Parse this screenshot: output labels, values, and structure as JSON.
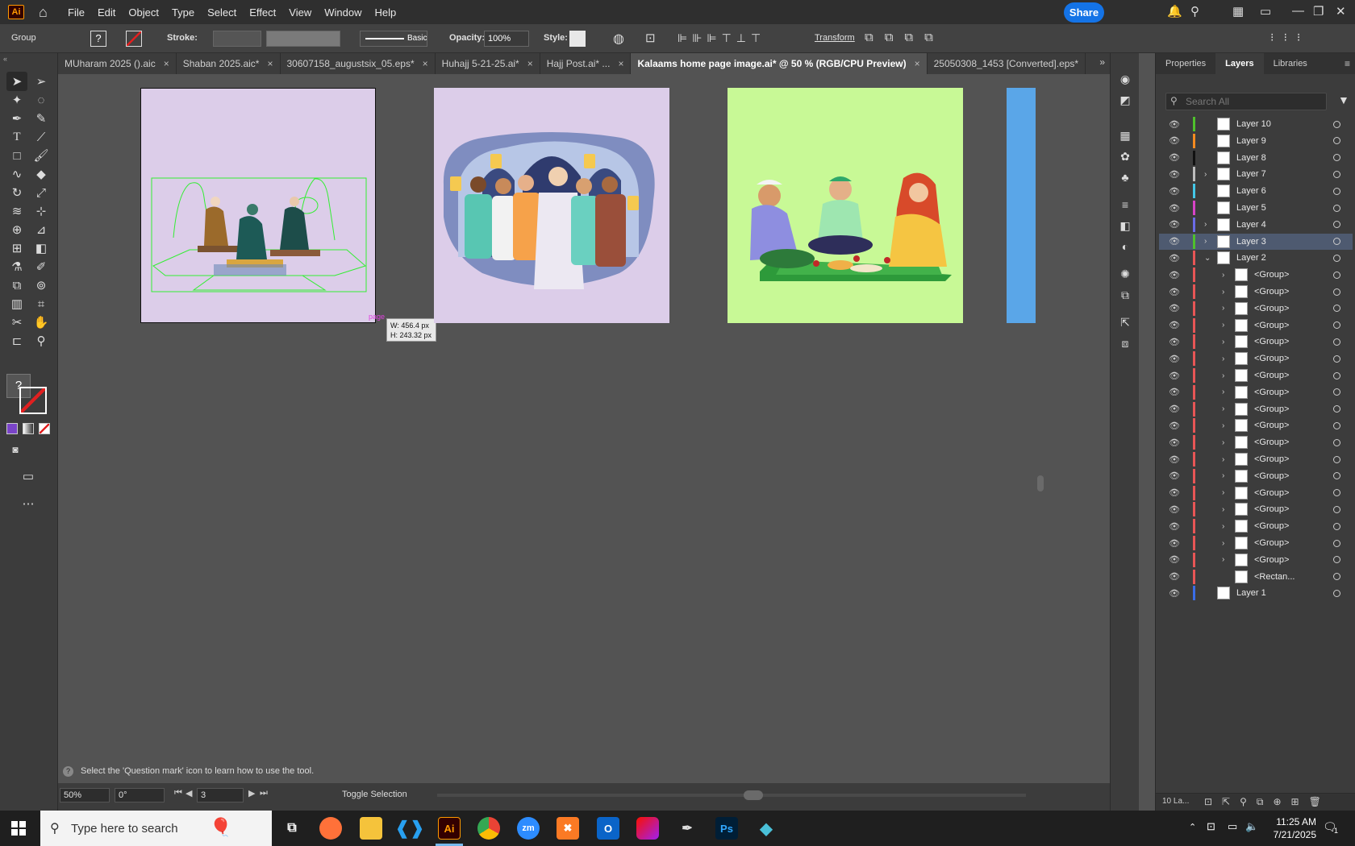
{
  "app": {
    "logo": "Ai",
    "menu": [
      "File",
      "Edit",
      "Object",
      "Type",
      "Select",
      "Effect",
      "View",
      "Window",
      "Help"
    ],
    "share_label": "Share"
  },
  "control_bar": {
    "selection_type": "Group",
    "stroke_label": "Stroke:",
    "brush_style": "Basic",
    "opacity_label": "Opacity:",
    "opacity_value": "100%",
    "style_label": "Style:",
    "transform_label": "Transform"
  },
  "tabs": [
    {
      "label": "MUharam 2025 ().aic",
      "close": "×"
    },
    {
      "label": "Shaban 2025.aic*",
      "close": "×"
    },
    {
      "label": "30607158_augustsix_05.eps*",
      "close": "×"
    },
    {
      "label": "Huhajj 5-21-25.ai*",
      "close": "×"
    },
    {
      "label": "Hajj Post.ai* ...",
      "close": "×"
    },
    {
      "label": "Kalaams home page image.ai* @ 50 % (RGB/CPU Preview)",
      "close": "×"
    },
    {
      "label": "25050308_1453 [Converted].eps*",
      "close": ""
    }
  ],
  "canvas": {
    "tooltip_w": "W: 456.4 px",
    "tooltip_h": "H: 243.32 px",
    "smart_guide": "page",
    "artboard_colors": [
      "#dccde9",
      "#dccde9",
      "#c8f996",
      "#5aa6e8"
    ]
  },
  "status": {
    "hint": "Select the 'Question mark' icon to learn how to use the tool.",
    "zoom": "50%",
    "rotation": "0°",
    "artboard_num": "3",
    "mode": "Toggle Selection"
  },
  "layers_panel": {
    "tabs": [
      "Properties",
      "Layers",
      "Libraries"
    ],
    "search_placeholder": "Search All",
    "footer_count": "10 La...",
    "layers": [
      {
        "name": "Layer 10",
        "color": "#4fc12c",
        "indent": 0,
        "expand": "",
        "selected": false
      },
      {
        "name": "Layer 9",
        "color": "#f48b20",
        "indent": 0,
        "expand": "",
        "selected": false
      },
      {
        "name": "Layer 8",
        "color": "#111111",
        "indent": 0,
        "expand": "",
        "selected": false
      },
      {
        "name": "Layer 7",
        "color": "#bdbdbd",
        "indent": 0,
        "expand": ">",
        "selected": false
      },
      {
        "name": "Layer 6",
        "color": "#44c8e8",
        "indent": 0,
        "expand": "",
        "selected": false
      },
      {
        "name": "Layer 5",
        "color": "#d844c8",
        "indent": 0,
        "expand": "",
        "selected": false
      },
      {
        "name": "Layer 4",
        "color": "#6b6be8",
        "indent": 0,
        "expand": ">",
        "selected": false
      },
      {
        "name": "Layer 3",
        "color": "#4fc12c",
        "indent": 0,
        "expand": ">",
        "selected": true
      },
      {
        "name": "Layer 2",
        "color": "#e85656",
        "indent": 0,
        "expand": "v",
        "selected": false
      },
      {
        "name": "<Group>",
        "color": "#e85656",
        "indent": 1,
        "expand": ">",
        "selected": false
      },
      {
        "name": "<Group>",
        "color": "#e85656",
        "indent": 1,
        "expand": ">",
        "selected": false
      },
      {
        "name": "<Group>",
        "color": "#e85656",
        "indent": 1,
        "expand": ">",
        "selected": false
      },
      {
        "name": "<Group>",
        "color": "#e85656",
        "indent": 1,
        "expand": ">",
        "selected": false
      },
      {
        "name": "<Group>",
        "color": "#e85656",
        "indent": 1,
        "expand": ">",
        "selected": false
      },
      {
        "name": "<Group>",
        "color": "#e85656",
        "indent": 1,
        "expand": ">",
        "selected": false
      },
      {
        "name": "<Group>",
        "color": "#e85656",
        "indent": 1,
        "expand": ">",
        "selected": false
      },
      {
        "name": "<Group>",
        "color": "#e85656",
        "indent": 1,
        "expand": ">",
        "selected": false
      },
      {
        "name": "<Group>",
        "color": "#e85656",
        "indent": 1,
        "expand": ">",
        "selected": false
      },
      {
        "name": "<Group>",
        "color": "#e85656",
        "indent": 1,
        "expand": ">",
        "selected": false
      },
      {
        "name": "<Group>",
        "color": "#e85656",
        "indent": 1,
        "expand": ">",
        "selected": false
      },
      {
        "name": "<Group>",
        "color": "#e85656",
        "indent": 1,
        "expand": ">",
        "selected": false
      },
      {
        "name": "<Group>",
        "color": "#e85656",
        "indent": 1,
        "expand": ">",
        "selected": false
      },
      {
        "name": "<Group>",
        "color": "#e85656",
        "indent": 1,
        "expand": ">",
        "selected": false
      },
      {
        "name": "<Group>",
        "color": "#e85656",
        "indent": 1,
        "expand": ">",
        "selected": false
      },
      {
        "name": "<Group>",
        "color": "#e85656",
        "indent": 1,
        "expand": ">",
        "selected": false
      },
      {
        "name": "<Group>",
        "color": "#e85656",
        "indent": 1,
        "expand": ">",
        "selected": false
      },
      {
        "name": "<Group>",
        "color": "#e85656",
        "indent": 1,
        "expand": ">",
        "selected": false
      },
      {
        "name": "<Rectan...",
        "color": "#e85656",
        "indent": 1,
        "expand": "",
        "selected": false
      },
      {
        "name": "Layer 1",
        "color": "#3a6de8",
        "indent": 0,
        "expand": "",
        "selected": false
      }
    ]
  },
  "taskbar": {
    "search_placeholder": "Type here to search",
    "time": "11:25 AM",
    "date": "7/21/2025",
    "apps": [
      "Firefox",
      "Files",
      "VS Code",
      "Ai",
      "Chrome",
      "zm",
      "XAMPP",
      "Outlook",
      "CC",
      "Pen",
      "Ps",
      "App"
    ],
    "notification_count": "1"
  }
}
